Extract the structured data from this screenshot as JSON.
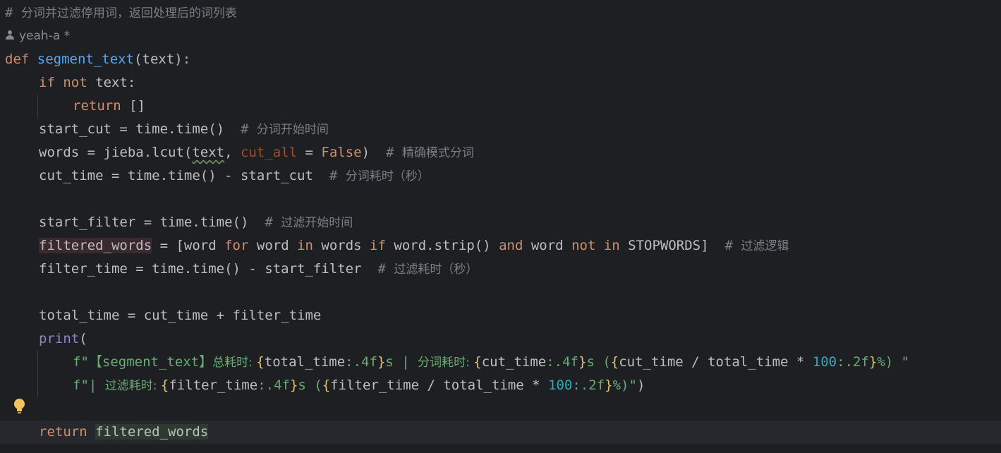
{
  "comment_header": {
    "hash": "#",
    "text": "分词并过滤停用词，返回处理后的词列表"
  },
  "author": {
    "name": "yeah-a",
    "modified_marker": "*"
  },
  "code": {
    "l_def": {
      "kw": "def",
      "fn": "segment_text",
      "rest": "(text):"
    },
    "l_if": {
      "kw1": "if",
      "kw2": "not",
      "rest": "text:"
    },
    "l_ret_empty": {
      "kw": "return",
      "rest": "[]"
    },
    "l_start_cut": {
      "code": "start_cut = time.time()",
      "hash": "#",
      "comment": "分词开始时间"
    },
    "l_words": {
      "a": "words = jieba.lcut(",
      "arg": "text",
      "b": ", ",
      "named": "cut_all",
      "c": " = ",
      "kw": "False",
      "d": ")",
      "hash": "#",
      "comment": "精确模式分词"
    },
    "l_cut_time": {
      "code": "cut_time = time.time() - start_cut",
      "hash": "#",
      "comment": "分词耗时（秒）"
    },
    "l_start_filter": {
      "code": "start_filter = time.time()",
      "hash": "#",
      "comment": "过滤开始时间"
    },
    "l_filtered": {
      "var": "filtered_words",
      "a": " = [word ",
      "k1": "for",
      "b": " word ",
      "k2": "in",
      "c": " words ",
      "k3": "if",
      "d": " word.strip() ",
      "k4": "and",
      "e": " word ",
      "k5": "not",
      "k6": "in",
      "f": " STOPWORDS]",
      "hash": "#",
      "comment": "过滤逻辑"
    },
    "l_filter_time": {
      "code": "filter_time = time.time() - start_filter",
      "hash": "#",
      "comment": "过滤耗时（秒）"
    },
    "l_total": {
      "code": "total_time = cut_time + filter_time"
    },
    "l_print": {
      "bi": "print",
      "rest": "("
    },
    "l_f1": {
      "p1": "f\"【segment_text】",
      "p1c": "总耗时: ",
      "o1": "{",
      "v1": "total_time",
      "s1": ":.4f",
      "c1": "}",
      "p2": "s | ",
      "p2c": "分词耗时: ",
      "o2": "{",
      "v2": "cut_time",
      "s2": ":.4f",
      "c2": "}",
      "p3": "s (",
      "o3": "{",
      "v3": "cut_time / total_time * ",
      "n3": "100",
      "s3": ":.2f",
      "c3": "}",
      "p4": "%) \""
    },
    "l_f2": {
      "p1": "f\"| ",
      "p1c": "过滤耗时: ",
      "o1": "{",
      "v1": "filter_time",
      "s1": ":.4f",
      "c1": "}",
      "p2": "s (",
      "o2": "{",
      "v2": "filter_time / total_time * ",
      "n2": "100",
      "s2": ":.2f",
      "c2": "}",
      "p3": "%)\"",
      "close": ")"
    },
    "l_return": {
      "kw": "return",
      "var": "filtered_words"
    }
  },
  "colors": {
    "background": "#1e1f22",
    "keyword": "#cf8e6d",
    "function": "#56a8f5",
    "string": "#6aab73",
    "number": "#2aacb8",
    "comment": "#7a7e85",
    "brace": "#e0c46c",
    "builtin": "#8888c6",
    "named_arg": "#aa4926"
  },
  "icons": {
    "author": "person-icon",
    "intention": "bulb-icon"
  }
}
